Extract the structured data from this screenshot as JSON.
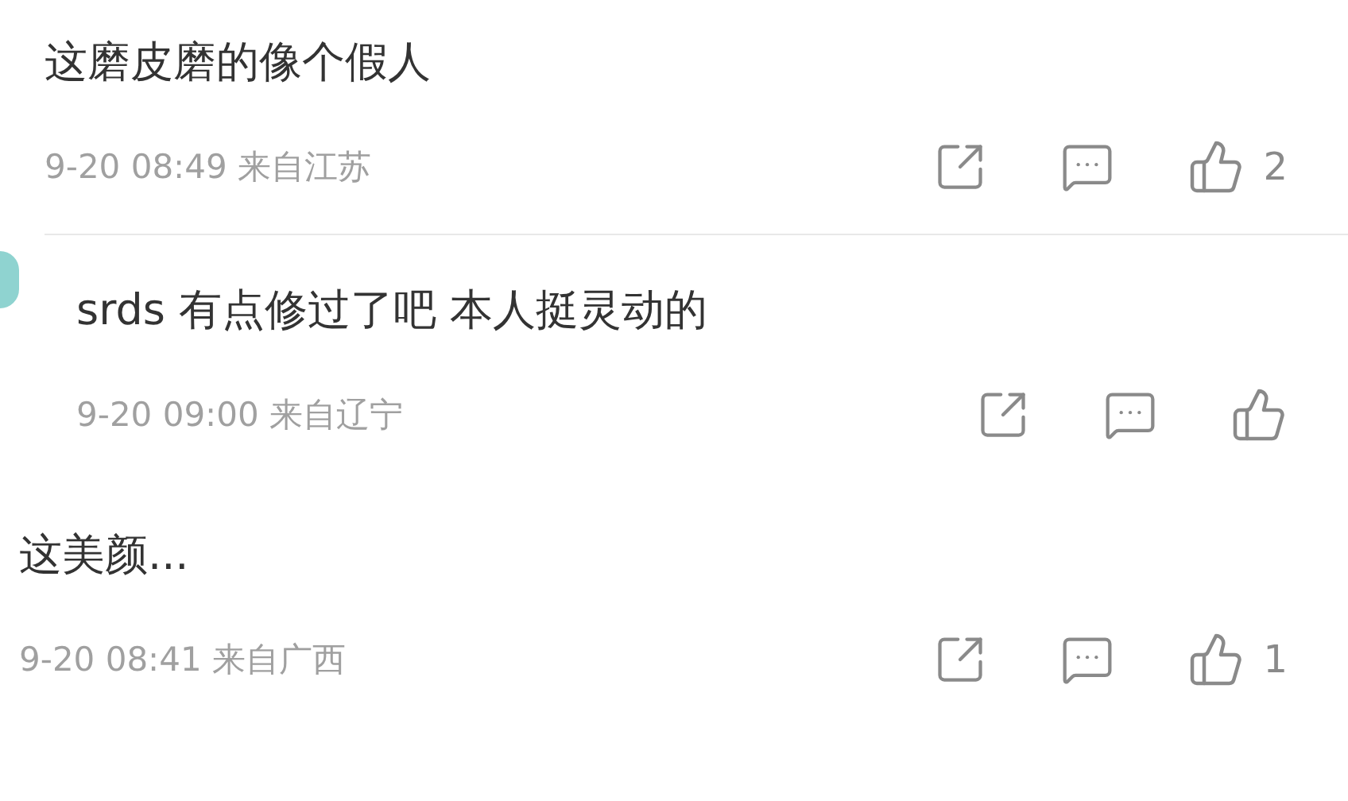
{
  "comments": [
    {
      "text": "这磨皮磨的像个假人",
      "meta": "9-20 08:49 来自江苏",
      "likes": "2"
    },
    {
      "text": "srds 有点修过了吧 本人挺灵动的",
      "meta": "9-20 09:00 来自辽宁"
    },
    {
      "text": "这美颜...",
      "meta": "9-20 08:41 来自广西",
      "likes": "1"
    }
  ]
}
